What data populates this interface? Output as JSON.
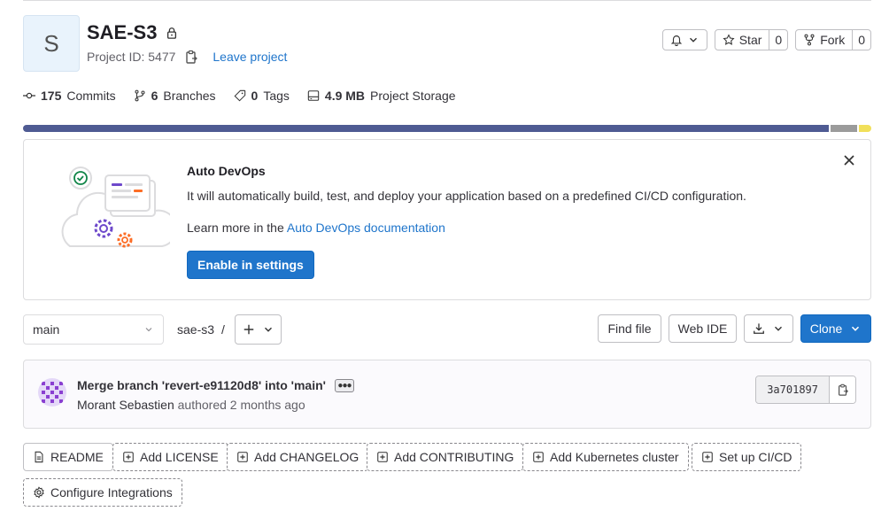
{
  "project": {
    "avatar_letter": "S",
    "name": "SAE-S3",
    "id_text": "Project ID: 5477",
    "leave_label": "Leave project"
  },
  "header_buttons": {
    "star_label": "Star",
    "star_count": "0",
    "fork_label": "Fork",
    "fork_count": "0"
  },
  "stats": {
    "commits_count": "175",
    "commits_label": "Commits",
    "branches_count": "6",
    "branches_label": "Branches",
    "tags_count": "0",
    "tags_label": "Tags",
    "storage_size": "4.9 MB",
    "storage_label": "Project Storage"
  },
  "language_bar": [
    {
      "fraction": 0.954,
      "color": "#4f5b93"
    },
    {
      "fraction": 0.031,
      "color": "#9b9b9b"
    },
    {
      "fraction": 0.015,
      "color": "#f1e05a"
    }
  ],
  "auto_devops": {
    "title": "Auto DevOps",
    "description": "It will automatically build, test, and deploy your application based on a predefined CI/CD configuration.",
    "learn_prefix": "Learn more in the ",
    "learn_link": "Auto DevOps documentation",
    "enable_label": "Enable in settings"
  },
  "repo": {
    "branch": "main",
    "path": "sae-s3",
    "separator": "/",
    "find_file": "Find file",
    "web_ide": "Web IDE",
    "clone": "Clone"
  },
  "commit": {
    "message": "Merge branch 'revert-e91120d8' into 'main'",
    "author": "Morant Sebastien",
    "authored_text": "authored 2 months ago",
    "sha": "3a701897"
  },
  "actions": {
    "readme": "README",
    "license": "Add LICENSE",
    "changelog": "Add CHANGELOG",
    "contributing": "Add CONTRIBUTING",
    "kubernetes": "Add Kubernetes cluster",
    "cicd": "Set up CI/CD",
    "integrations": "Configure Integrations"
  }
}
